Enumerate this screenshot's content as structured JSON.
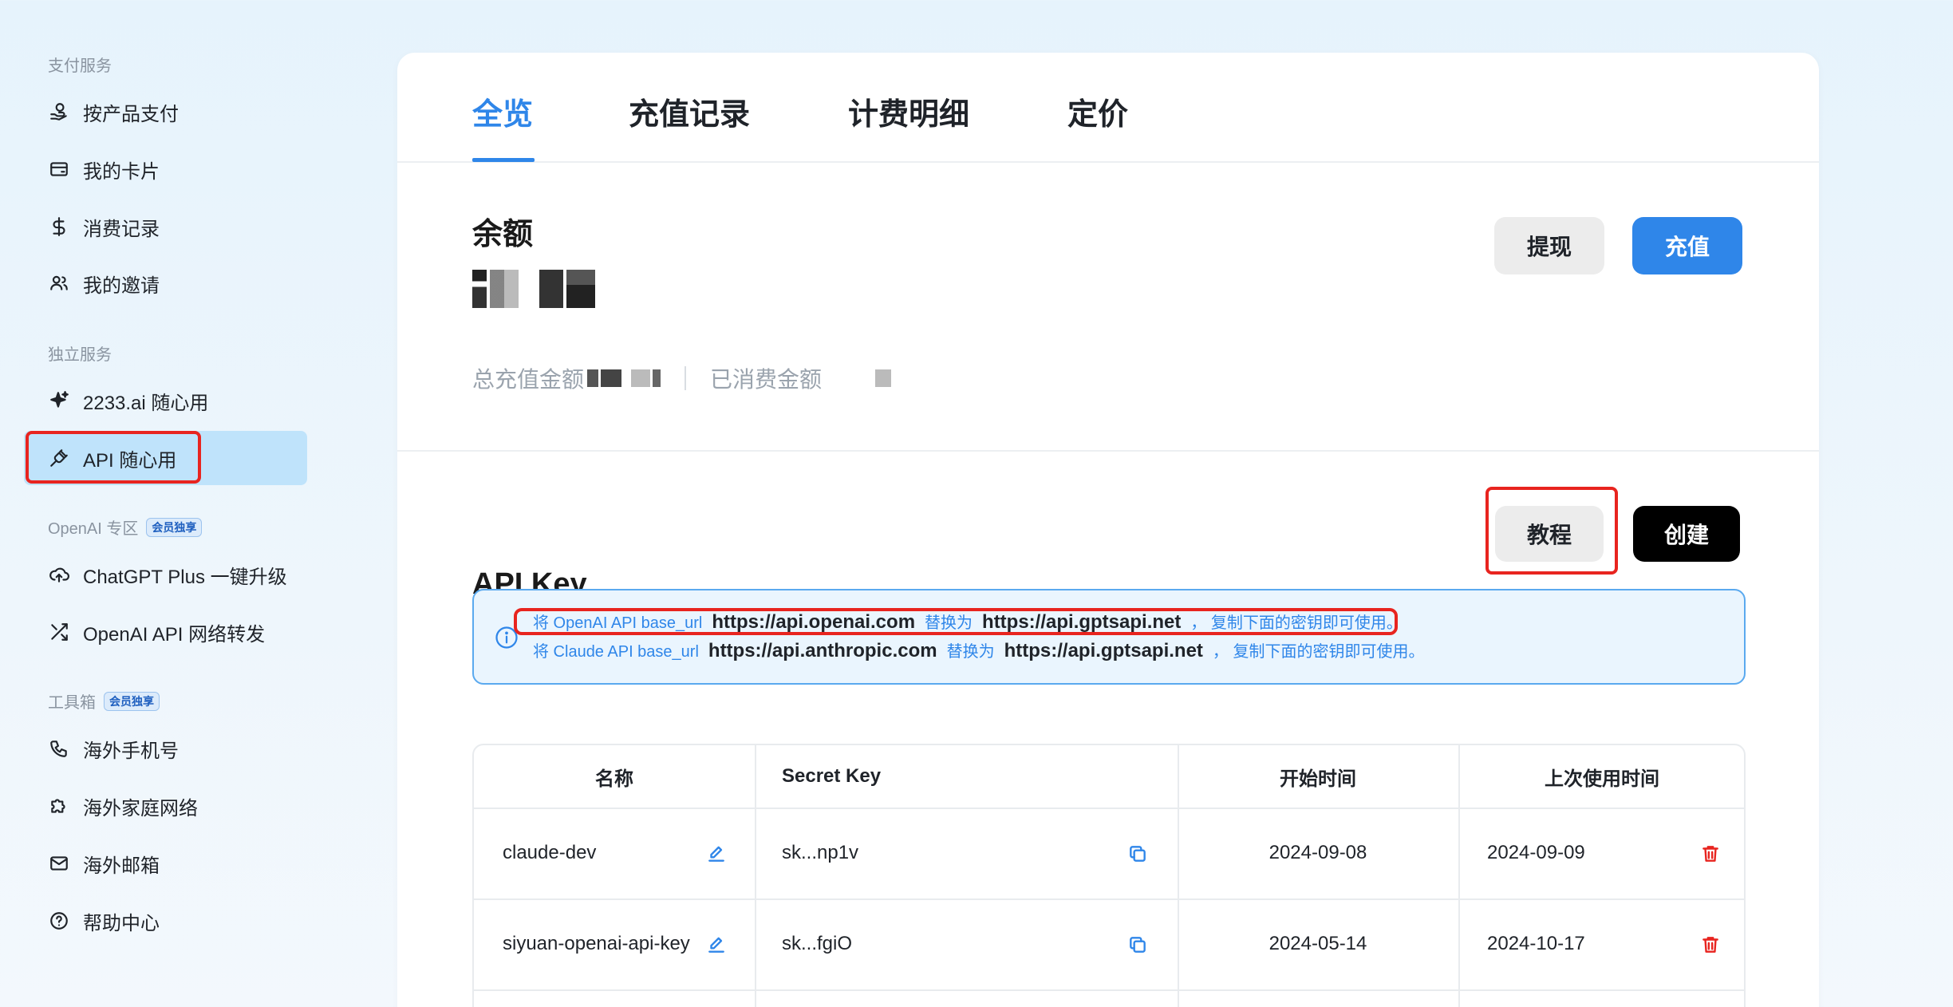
{
  "sidebar": {
    "sections": [
      {
        "title": "支付服务"
      },
      {
        "title": "独立服务"
      },
      {
        "title": "OpenAI 专区",
        "badge": "会员独享"
      },
      {
        "title": "工具箱",
        "badge": "会员独享"
      }
    ],
    "items": [
      {
        "label": "按产品支付",
        "icon": "coin-hand-icon"
      },
      {
        "label": "我的卡片",
        "icon": "credit-card-icon"
      },
      {
        "label": "消费记录",
        "icon": "dollar-icon"
      },
      {
        "label": "我的邀请",
        "icon": "users-icon"
      },
      {
        "label": "2233.ai 随心用",
        "icon": "sparkle-icon"
      },
      {
        "label": "API 随心用",
        "icon": "plug-icon",
        "active": true
      },
      {
        "label": "ChatGPT Plus 一键升级",
        "icon": "cloud-upload-icon"
      },
      {
        "label": "OpenAI API 网络转发",
        "icon": "shuffle-icon"
      },
      {
        "label": "海外手机号",
        "icon": "phone-icon"
      },
      {
        "label": "海外家庭网络",
        "icon": "puzzle-icon"
      },
      {
        "label": "海外邮箱",
        "icon": "mail-icon"
      },
      {
        "label": "帮助中心",
        "icon": "help-icon"
      }
    ]
  },
  "tabs": [
    "全览",
    "充值记录",
    "计费明细",
    "定价"
  ],
  "balance": {
    "title": "余额",
    "total_recharge_label": "总充值金额",
    "consumed_label": "已消费金额",
    "withdraw_button": "提现",
    "recharge_button": "充值"
  },
  "apikey": {
    "title": "API Key",
    "tutorial_button": "教程",
    "create_button": "创建",
    "info": [
      {
        "prefix": "将 OpenAI API base_url",
        "from": "https://api.openai.com",
        "mid": "替换为",
        "to": "https://api.gptsapi.net",
        "suffix": "， 复制下面的密钥即可使用。"
      },
      {
        "prefix": "将 Claude API base_url",
        "from": "https://api.anthropic.com",
        "mid": "替换为",
        "to": "https://api.gptsapi.net",
        "suffix": "， 复制下面的密钥即可使用。"
      }
    ],
    "table": {
      "headers": [
        "名称",
        "Secret Key",
        "开始时间",
        "上次使用时间"
      ],
      "rows": [
        {
          "name": "claude-dev",
          "key": "sk...np1v",
          "start": "2024-09-08",
          "last": "2024-09-09"
        },
        {
          "name": "siyuan-openai-api-key",
          "key": "sk...fgiO",
          "start": "2024-05-14",
          "last": "2024-10-17"
        }
      ]
    }
  },
  "colors": {
    "accent": "#2f86e9",
    "highlight_red": "#e8241f",
    "active_bg": "#bfe3fb"
  }
}
